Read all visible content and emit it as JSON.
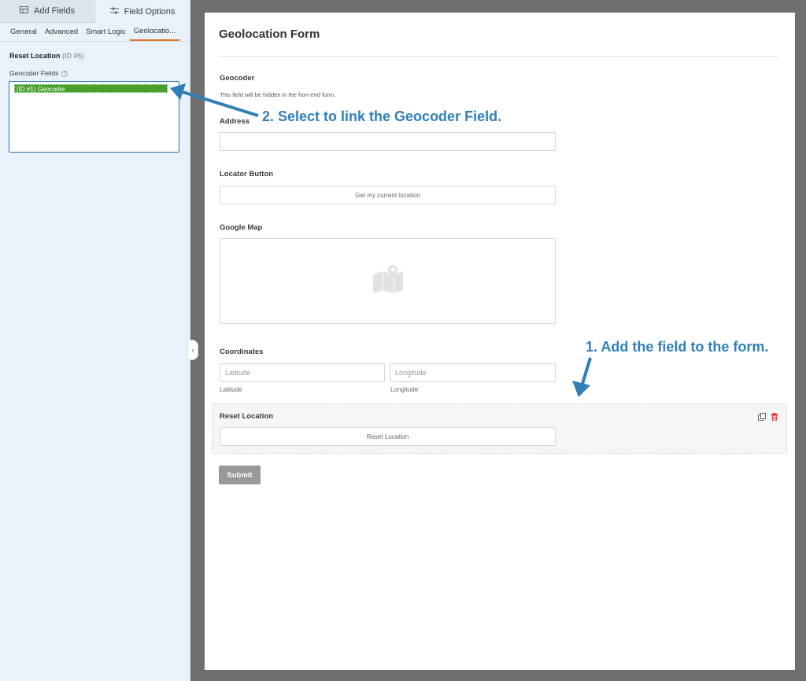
{
  "sidebar": {
    "main_tabs": [
      {
        "label": "Add Fields",
        "icon": "table-icon"
      },
      {
        "label": "Field Options",
        "icon": "sliders-icon"
      }
    ],
    "sub_tabs": [
      "General",
      "Advanced",
      "Smart Logic",
      "Geolocatio..."
    ],
    "field_title": "Reset Location",
    "field_id": "(ID #6)",
    "geocoder_label": "Geocoder Fields",
    "geocoder_options": [
      "(ID #1) Geocoder"
    ],
    "help_glyph": "?",
    "collapse_glyph": "‹"
  },
  "form": {
    "title": "Geolocation Form",
    "geocoder": {
      "label": "Geocoder",
      "description": "This field will be hidden in the fron-end form."
    },
    "address": {
      "label": "Address"
    },
    "locator": {
      "label": "Locator Button",
      "button": "Get my current location"
    },
    "map": {
      "label": "Google Map",
      "icon": "map-pin-icon"
    },
    "coordinates": {
      "label": "Coordinates",
      "lat_placeholder": "Latitude",
      "lng_placeholder": "Longitude",
      "lat_sublabel": "Latitude",
      "lng_sublabel": "Longitude"
    },
    "reset": {
      "label": "Reset Location",
      "button": "Reset Location"
    },
    "submit": "Submit"
  },
  "annotations": {
    "step1": "1. Add the field to the form.",
    "step2": "2. Select to link the Geocoder Field."
  },
  "colors": {
    "annotation": "#2f80b8",
    "selected_option": "#4a9f2b",
    "active_tab_underline": "#e27730",
    "delete_icon": "#e0383e"
  }
}
